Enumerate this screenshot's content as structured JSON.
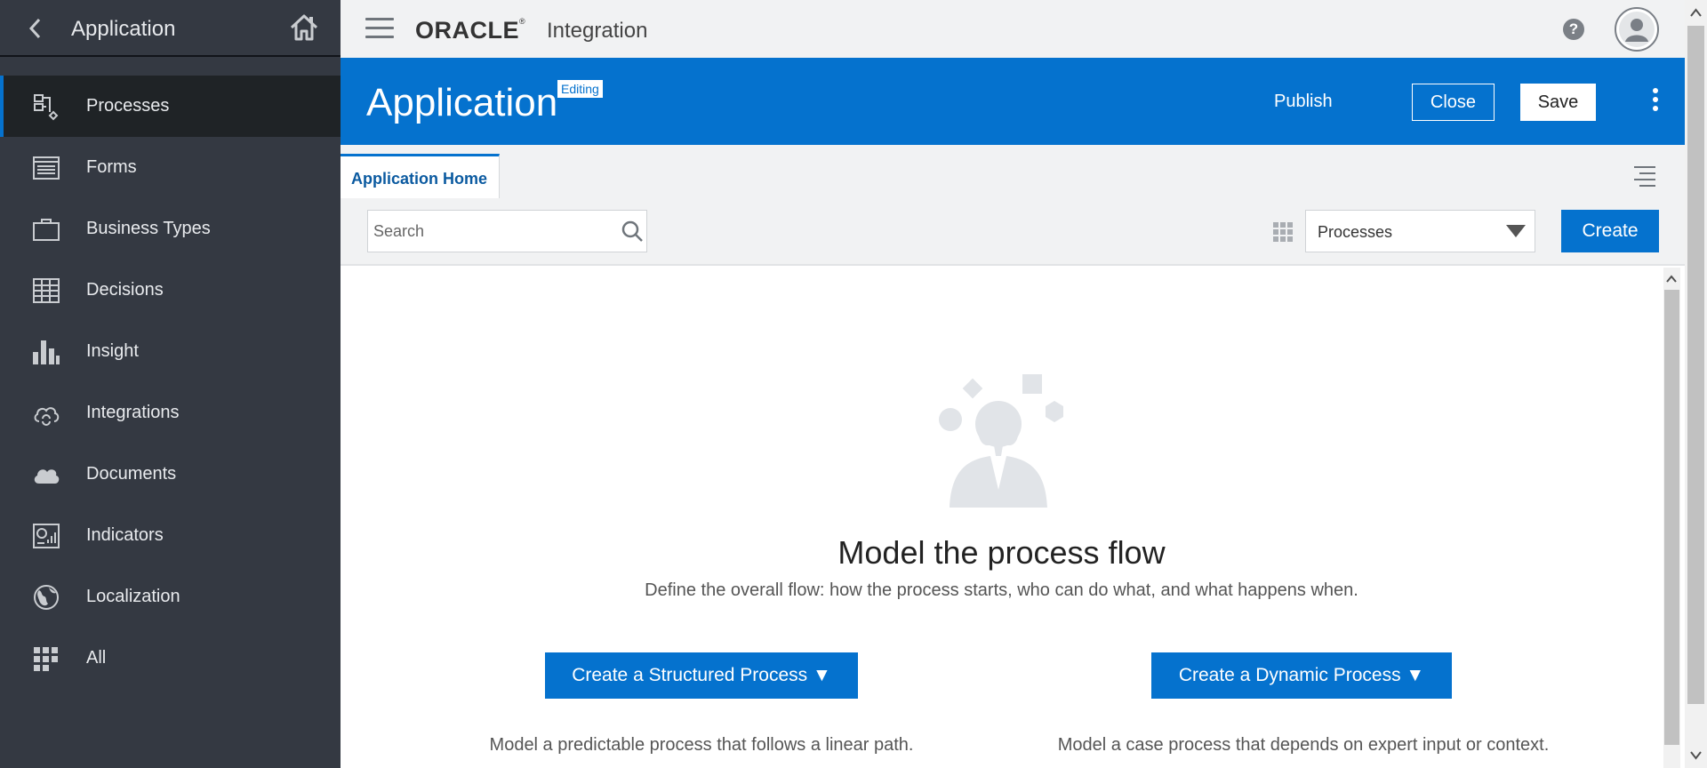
{
  "sidebar": {
    "title": "Application",
    "items": [
      {
        "label": "Processes",
        "icon": "processes-icon",
        "active": true
      },
      {
        "label": "Forms",
        "icon": "forms-icon"
      },
      {
        "label": "Business Types",
        "icon": "briefcase-icon"
      },
      {
        "label": "Decisions",
        "icon": "table-grid-icon"
      },
      {
        "label": "Insight",
        "icon": "bar-chart-icon"
      },
      {
        "label": "Integrations",
        "icon": "cloud-sync-icon"
      },
      {
        "label": "Documents",
        "icon": "cloud-docs-icon"
      },
      {
        "label": "Indicators",
        "icon": "dashboard-icon"
      },
      {
        "label": "Localization",
        "icon": "globe-icon"
      },
      {
        "label": "All",
        "icon": "apps-grid-icon"
      }
    ]
  },
  "topbar": {
    "brand": "ORACLE",
    "product": "Integration",
    "help": "?"
  },
  "header": {
    "title": "Application",
    "badge": "Editing",
    "publish_label": "Publish",
    "close_label": "Close",
    "save_label": "Save"
  },
  "tabs": [
    {
      "label": "Application Home",
      "active": true
    }
  ],
  "toolbar": {
    "search_placeholder": "Search",
    "filter_value": "Processes",
    "create_label": "Create"
  },
  "main": {
    "heading": "Model the process flow",
    "subheading": "Define the overall flow: how the process starts, who can do what, and what happens when.",
    "structured_button": "Create a Structured Process ▼",
    "dynamic_button": "Create a Dynamic Process ▼",
    "structured_desc": "Model a predictable process that follows a linear path.",
    "dynamic_desc": "Model a case process that depends on expert input or context."
  },
  "colors": {
    "sidebar_bg": "#343942",
    "accent": "#0572ce",
    "topbar_bg": "#f1f2f3"
  }
}
